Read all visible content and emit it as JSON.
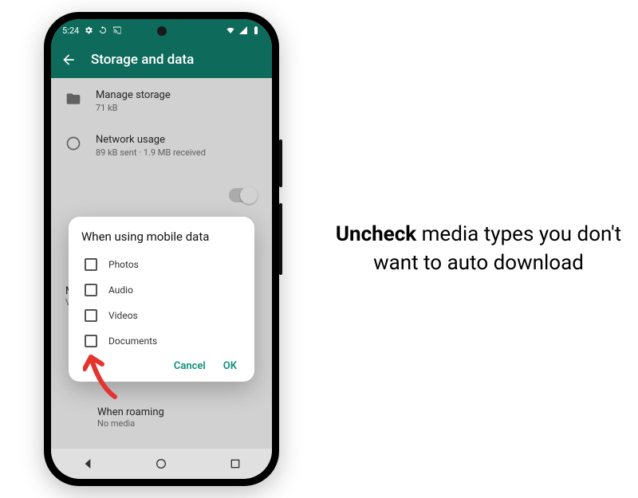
{
  "status": {
    "time": "5:24",
    "icons_left": [
      "gear-icon",
      "sync-icon",
      "cast-icon"
    ],
    "icons_right": [
      "wifi-icon",
      "signal-icon",
      "battery-icon"
    ]
  },
  "header": {
    "title": "Storage and data"
  },
  "rows": {
    "manage_storage": {
      "title": "Manage storage",
      "sub": "71 kB"
    },
    "network_usage": {
      "title": "Network usage",
      "sub": "89 kB sent · 1.9 MB received"
    }
  },
  "partial": {
    "line1": "M",
    "line2": "V"
  },
  "when_roaming": {
    "title": "When roaming",
    "sub": "No media"
  },
  "dialog": {
    "title": "When using mobile data",
    "options": [
      "Photos",
      "Audio",
      "Videos",
      "Documents"
    ],
    "cancel": "Cancel",
    "ok": "OK"
  },
  "caption": {
    "bold": "Uncheck",
    "rest": " media types you don't want to auto download"
  }
}
